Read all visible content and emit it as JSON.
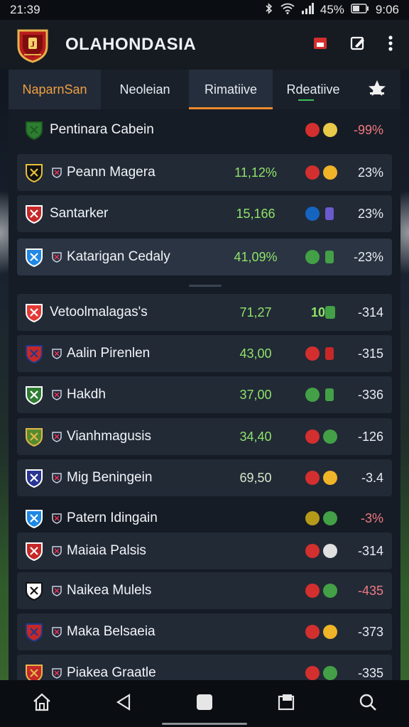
{
  "status": {
    "time": "21:39",
    "battery": "45%",
    "clock": "9:06"
  },
  "app": {
    "title": "OLAHONDASIA"
  },
  "tabs": [
    {
      "label": "NaparnSan"
    },
    {
      "label": "Neoleian"
    },
    {
      "label": "Rimatiive"
    },
    {
      "label": "Rdeatiive"
    }
  ],
  "rows": [
    {
      "name": "Pentinara Cabein",
      "value": "",
      "pct": "-99%",
      "crest": [
        "#2e7d32",
        "#1b5e20"
      ],
      "mini": false,
      "pills": [
        "#d32f2f",
        "#e8c94a"
      ],
      "pct_neg": true
    },
    {
      "name": "Peann Magera",
      "value": "11,12%",
      "pct": "23%",
      "crest": [
        "#111",
        "#e8c13a"
      ],
      "mini": true,
      "pills": [
        "#d32f2f",
        "#f0b429"
      ],
      "pct_neg": false
    },
    {
      "name": "Santarker",
      "value": "15,166",
      "pct": "23%",
      "crest": [
        "#c62828",
        "#fff"
      ],
      "mini": false,
      "pills": [
        "#1565c0",
        "#6a5acd"
      ],
      "pct_neg": false
    },
    {
      "name": "Katarigan Cedaly",
      "value": "41,09%",
      "pct": "-23%",
      "crest": [
        "#1e88e5",
        "#fff"
      ],
      "mini": true,
      "pills": [
        "#43a047",
        "#43a047"
      ],
      "pct_neg": false
    },
    {
      "name": "Vetoolmalagas's",
      "value": "71,27",
      "pct": "-314",
      "crest": [
        "#e53935",
        "#fff"
      ],
      "mini": false,
      "pills": [],
      "pct_neg": false
    },
    {
      "name": "Aalin Pirenlen",
      "value": "43,00",
      "pct": "-315",
      "crest": [
        "#c62828",
        "#1e3a8a"
      ],
      "mini": true,
      "pills": [
        "#d32f2f",
        "#c62828"
      ],
      "pct_neg": false
    },
    {
      "name": "Hakdh",
      "value": "37,00",
      "pct": "-336",
      "crest": [
        "#2e7d32",
        "#fff"
      ],
      "mini": true,
      "pills": [
        "#43a047",
        "#43a047"
      ],
      "pct_neg": false
    },
    {
      "name": "Vianhmagusis",
      "value": "34,40",
      "pct": "-126",
      "crest": [
        "#558b2f",
        "#e2b84a"
      ],
      "mini": true,
      "pills": [
        "#d32f2f",
        "#43a047"
      ],
      "pct_neg": false
    },
    {
      "name": "Mig Beningein",
      "value": "69,50",
      "pct": "-3.4",
      "crest": [
        "#283593",
        "#fff"
      ],
      "mini": true,
      "pills": [
        "#d32f2f",
        "#f0b429"
      ],
      "pct_neg": false
    },
    {
      "name": "Patern Idingain",
      "value": "",
      "pct": "-3%",
      "crest": [
        "#1e88e5",
        "#fff"
      ],
      "mini": true,
      "pills": [
        "#b59a1a",
        "#43a047"
      ],
      "pct_neg": true
    },
    {
      "name": "Maiaia Palsis",
      "value": "",
      "pct": "-314",
      "crest": [
        "#c62828",
        "#fff"
      ],
      "mini": true,
      "pills": [
        "#d32f2f",
        "#e0e0e0"
      ],
      "pct_neg": false
    },
    {
      "name": "Naikea Mulels",
      "value": "",
      "pct": "-435",
      "crest": [
        "#fff",
        "#111"
      ],
      "mini": true,
      "pills": [
        "#d32f2f",
        "#43a047"
      ],
      "pct_neg": true
    },
    {
      "name": "Maka Belsaeia",
      "value": "",
      "pct": "-373",
      "crest": [
        "#c62828",
        "#1e3a8a"
      ],
      "mini": true,
      "pills": [
        "#d32f2f",
        "#f0b429"
      ],
      "pct_neg": false
    },
    {
      "name": "Piakea Graatle",
      "value": "",
      "pct": "-335",
      "crest": [
        "#c62828",
        "#e2b84a"
      ],
      "mini": true,
      "pills": [
        "#d32f2f",
        "#43a047"
      ],
      "pct_neg": false
    }
  ],
  "row_badges": {
    "vetool_number": "10"
  },
  "icons": {
    "nav": [
      "home-icon",
      "back-icon",
      "recents-square-icon",
      "window-icon",
      "search-icon"
    ],
    "appbar": [
      "flag-icon",
      "edit-icon",
      "more-vert-icon"
    ],
    "tabs": [
      "star-icon"
    ]
  },
  "colors": {
    "accent": "#f08a2c",
    "positive": "#8fe36a",
    "negative": "#f07a82"
  }
}
